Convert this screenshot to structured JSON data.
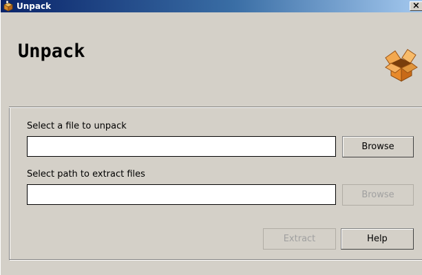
{
  "window": {
    "title": "Unpack",
    "close_glyph": "×"
  },
  "header": {
    "heading": "Unpack"
  },
  "icons": {
    "title_icon": "unpack-app-icon",
    "header_icon": "open-box-icon",
    "close_icon": "close-icon"
  },
  "form": {
    "file_label": "Select a file to unpack",
    "file_value": "",
    "browse_file_label": "Browse",
    "path_label": "Select path to extract files",
    "path_value": "",
    "browse_path_label": "Browse",
    "browse_path_enabled": false
  },
  "actions": {
    "extract_label": "Extract",
    "extract_enabled": false,
    "help_label": "Help"
  },
  "colors": {
    "titlebar_start": "#0a246a",
    "titlebar_end": "#a6caf0",
    "face": "#d4d0c8",
    "disabled_text": "#a0a0a0",
    "box_orange": "#e8892a"
  }
}
